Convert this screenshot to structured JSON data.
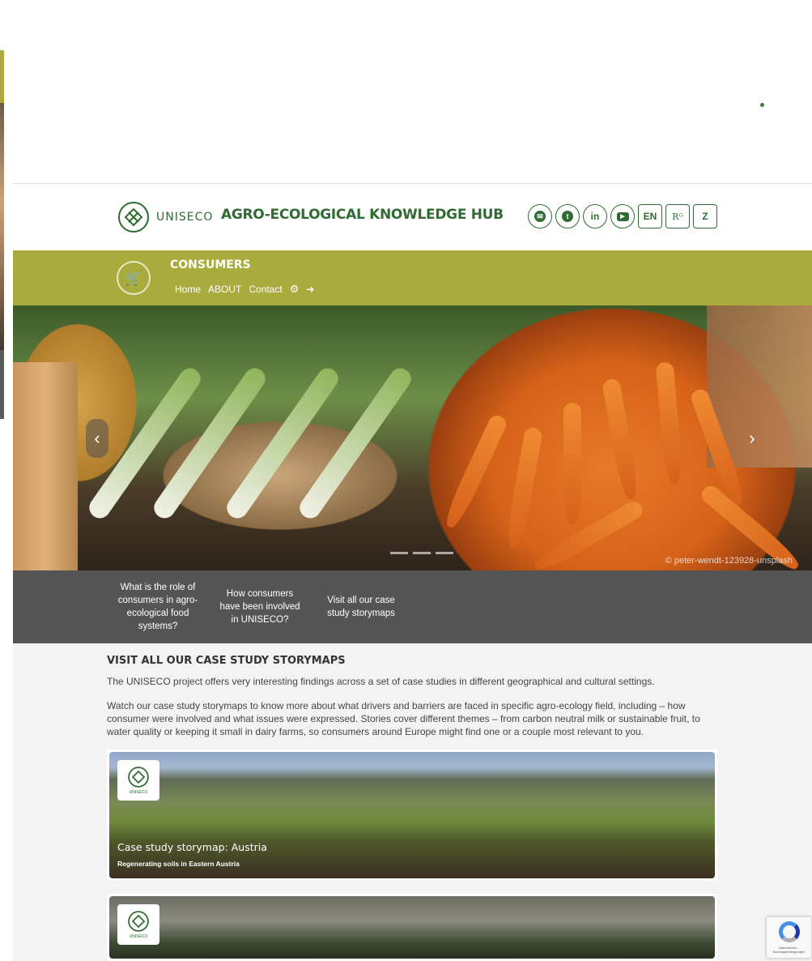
{
  "header": {
    "logo_text": "UNISECO",
    "hub_title": "AGRO-ECOLOGICAL KNOWLEDGE HUB",
    "social_buttons": [
      {
        "icon": "email-icon",
        "glyph": "✉"
      },
      {
        "icon": "twitter-icon",
        "glyph": "t"
      },
      {
        "icon": "linkedin-icon",
        "glyph": "in"
      },
      {
        "icon": "youtube-icon",
        "glyph": "▶"
      },
      {
        "icon": "language-en",
        "label": "EN"
      },
      {
        "icon": "researchgate-icon",
        "label": "Rᴳ"
      },
      {
        "icon": "zenodo-icon",
        "label": "Z"
      }
    ]
  },
  "section_bar": {
    "title": "CONSUMERS",
    "nav": [
      "Home",
      "ABOUT",
      "Contact"
    ],
    "icons": [
      "settings-icon",
      "logout-icon"
    ]
  },
  "hero": {
    "credit": "© peter-wendt-123928-unsplash",
    "prev_glyph": "‹",
    "next_glyph": "›"
  },
  "tabs": [
    "What is the role of consumers in agro-ecological food systems?",
    "How consumers have been involved in UNISECO?",
    "Visit all our case study storymaps"
  ],
  "content": {
    "section_title": "VISIT ALL OUR CASE STUDY STORYMAPS",
    "paragraph_1": "The UNISECO project offers very interesting findings across a set of case studies in different geographical and cultural settings.",
    "paragraph_2": "Watch our case study storymaps to know more  about what drivers and barriers are faced in specific agro-ecology field, including – how consumer were involved and what issues were expressed. Stories cover different themes – from carbon neutral milk or sustainable fruit, to water quality or keeping it small in dairy farms, so consumers around Europe might find one or a couple most relevant to you.",
    "cards": [
      {
        "title": "Case study storymap: Austria",
        "subtitle": "Regenerating soils in Eastern Austria",
        "badge_text": "UNISECO"
      },
      {
        "title": "",
        "subtitle": "",
        "badge_text": "UNISECO"
      }
    ]
  },
  "recaptcha": {
    "text": "Datenschutz - Nutzungsbedingungen"
  },
  "colors": {
    "brand_green": "#2f6b32",
    "olive_bar": "#a9ab3d",
    "tab_bar": "#555555",
    "content_bg": "#f3f3f3"
  }
}
